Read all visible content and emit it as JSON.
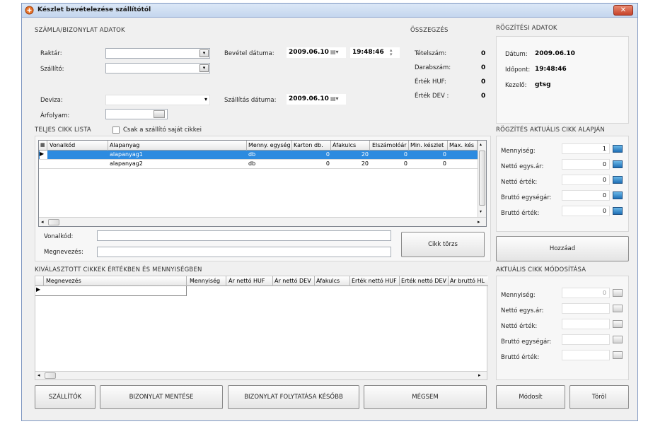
{
  "window": {
    "title": "Készlet bevételezése szállítótól",
    "close_glyph": "✕"
  },
  "invoice": {
    "section_title": "SZÁMLA/BIZONYLAT ADATOK",
    "warehouse_label": "Raktár:",
    "supplier_label": "Szállító:",
    "currency_label": "Deviza:",
    "rate_label": "Árfolyam:",
    "receipt_date_label": "Bevétel dátuma:",
    "receipt_date": "2009.06.10",
    "receipt_time": "19:48:46",
    "delivery_date_label": "Szállítás dátuma:",
    "delivery_date": "2009.06.10"
  },
  "summary": {
    "section_title": "ÖSSZEGZÉS",
    "rows": [
      {
        "label": "Tételszám:",
        "value": "0"
      },
      {
        "label": "Darabszám:",
        "value": "0"
      },
      {
        "label": "Érték HUF:",
        "value": "0"
      },
      {
        "label": "Érték DEV :",
        "value": "0"
      }
    ]
  },
  "record": {
    "section_title": "RÖGZÍTÉSI ADATOK",
    "date_label": "Dátum:",
    "date": "2009.06.10",
    "time_label": "Időpont:",
    "time": "19:48:46",
    "user_label": "Kezelő:",
    "user": "gtsg"
  },
  "items": {
    "section_title": "TELJES CIKK LISTA",
    "own_only_label": "Csak a szállító saját cikkei",
    "columns": [
      "Vonalkód",
      "Alapanyag",
      "Menny. egység",
      "Karton db.",
      "Áfakulcs",
      "Elszámolóár",
      "Min. készlet",
      "Max. kés"
    ],
    "rows": [
      {
        "barcode": "",
        "name": "alapanyag1",
        "unit": "db",
        "carton": "0",
        "vat": "20",
        "price": "0",
        "min": "0",
        "max": ""
      },
      {
        "barcode": "",
        "name": "alapanyag2",
        "unit": "db",
        "carton": "0",
        "vat": "20",
        "price": "0",
        "min": "0",
        "max": ""
      }
    ],
    "barcode_label": "Vonalkód:",
    "name_label": "Megnevezés:",
    "master_button": "Cikk törzs"
  },
  "add_current": {
    "section_title": "RÖGZÍTÉS AKTUÁLIS CIKK ALAPJÁN",
    "fields": [
      {
        "label": "Mennyiség:",
        "value": "1"
      },
      {
        "label": "Nettó egys.ár:",
        "value": "0"
      },
      {
        "label": "Nettó érték:",
        "value": "0"
      },
      {
        "label": "Bruttó egységár:",
        "value": "0"
      },
      {
        "label": "Bruttó érték:",
        "value": "0"
      }
    ],
    "add_button": "Hozzáad"
  },
  "selected": {
    "section_title": "KIVÁLASZTOTT CIKKEK ÉRTÉKBEN ÉS MENNYISÉGBEN",
    "columns": [
      "Megnevezés",
      "Mennyiség",
      "Ár nettó HUF",
      "Ár nettó DEV",
      "Áfakulcs",
      "Érték nettó HUF",
      "Érték nettó DEV",
      "Ár bruttó HL"
    ]
  },
  "modify": {
    "section_title": "AKTUÁLIS CIKK MÓDOSÍTÁSA",
    "fields": [
      {
        "label": "Mennyiség:",
        "value": "0"
      },
      {
        "label": "Nettó egys.ár:",
        "value": ""
      },
      {
        "label": "Nettó érték:",
        "value": ""
      },
      {
        "label": "Bruttó egységár:",
        "value": ""
      },
      {
        "label": "Bruttó érték:",
        "value": ""
      }
    ],
    "modify_button": "Módosít",
    "delete_button": "Töröl"
  },
  "footer": {
    "suppliers_button": "SZÁLLÍTÓK",
    "save_button": "BIZONYLAT MENTÉSE",
    "later_button": "BIZONYLAT  FOLYTATÁSA KÉSŐBB",
    "cancel_button": "MÉGSEM"
  }
}
